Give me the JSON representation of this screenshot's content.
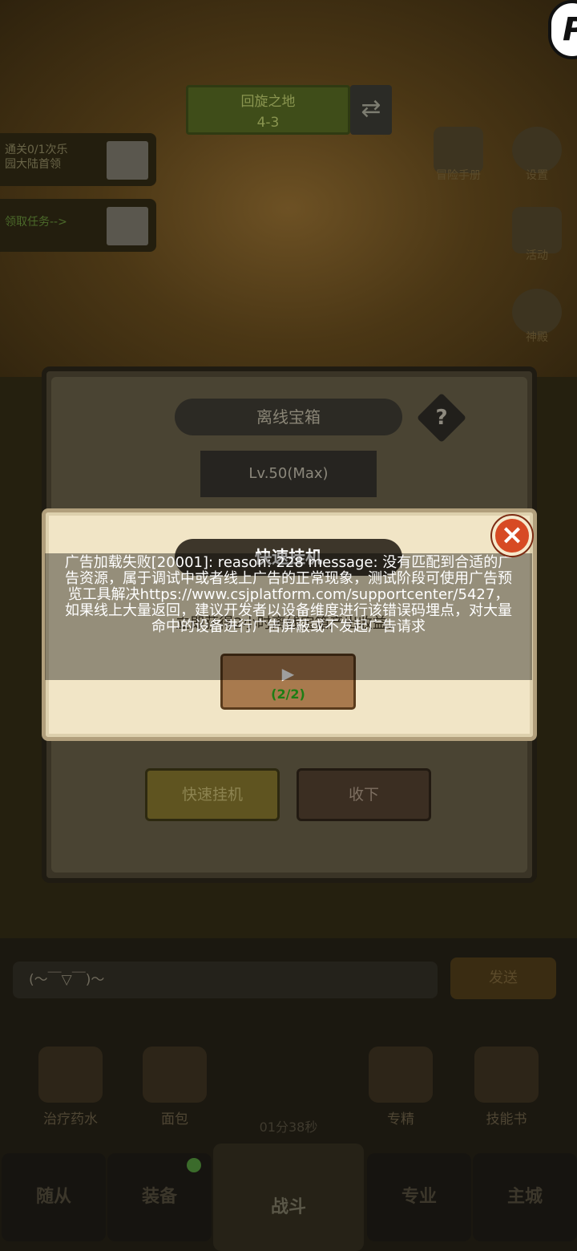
{
  "background": {
    "level_banner": {
      "name": "回旋之地",
      "stage": "4-3"
    },
    "quests": [
      {
        "text": "通关0/1次乐\n园大陆首领"
      },
      {
        "text": "领取任务-->"
      }
    ],
    "side_icons": [
      {
        "label": "冒险手册",
        "icon": "book-icon"
      },
      {
        "label": "设置",
        "icon": "gear-icon"
      },
      {
        "label": "活动",
        "icon": "calendar-icon"
      },
      {
        "label": "神殿",
        "icon": "temple-icon"
      }
    ],
    "chat_placeholder": "(～￣▽￣)～",
    "send_label": "发送",
    "items": [
      {
        "label": "治疗药水",
        "icon": "potion-icon"
      },
      {
        "label": "面包",
        "icon": "bread-icon"
      },
      {
        "label": "专精",
        "icon": "mastery-icon"
      },
      {
        "label": "技能书",
        "icon": "skillbook-icon"
      }
    ],
    "timer": "01分38秒",
    "nav": [
      {
        "label": "随从"
      },
      {
        "label": "装备"
      },
      {
        "label": "战斗"
      },
      {
        "label": "专业"
      },
      {
        "label": "主城"
      }
    ]
  },
  "chest_panel": {
    "title": "离线宝箱",
    "help": "?",
    "level": "Lv.50(Max)",
    "quick_button": "快速挂机",
    "collect_button": "收下"
  },
  "quick_dialog": {
    "title": "快速挂机",
    "description": "立即获得2小时离线宝箱产出收益。",
    "video_count": "(2/2)"
  },
  "toast": {
    "message": "广告加载失败[20001]: reason: 228  message: 没有匹配到合适的广告资源，属于调试中或者线上广告的正常现象，测试阶段可使用广告预览工具解决https://www.csjplatform.com/supportcenter/5427，如果线上大量返回，建议开发者以设备维度进行该错误码埋点，对大量命中的设备进行广告屏蔽或不发起广告请求"
  },
  "colors": {
    "dialog_bg": "#f1e5c6",
    "close_red": "#d74a24",
    "count_green": "#1d7d14",
    "video_button": "#a87a4e"
  }
}
